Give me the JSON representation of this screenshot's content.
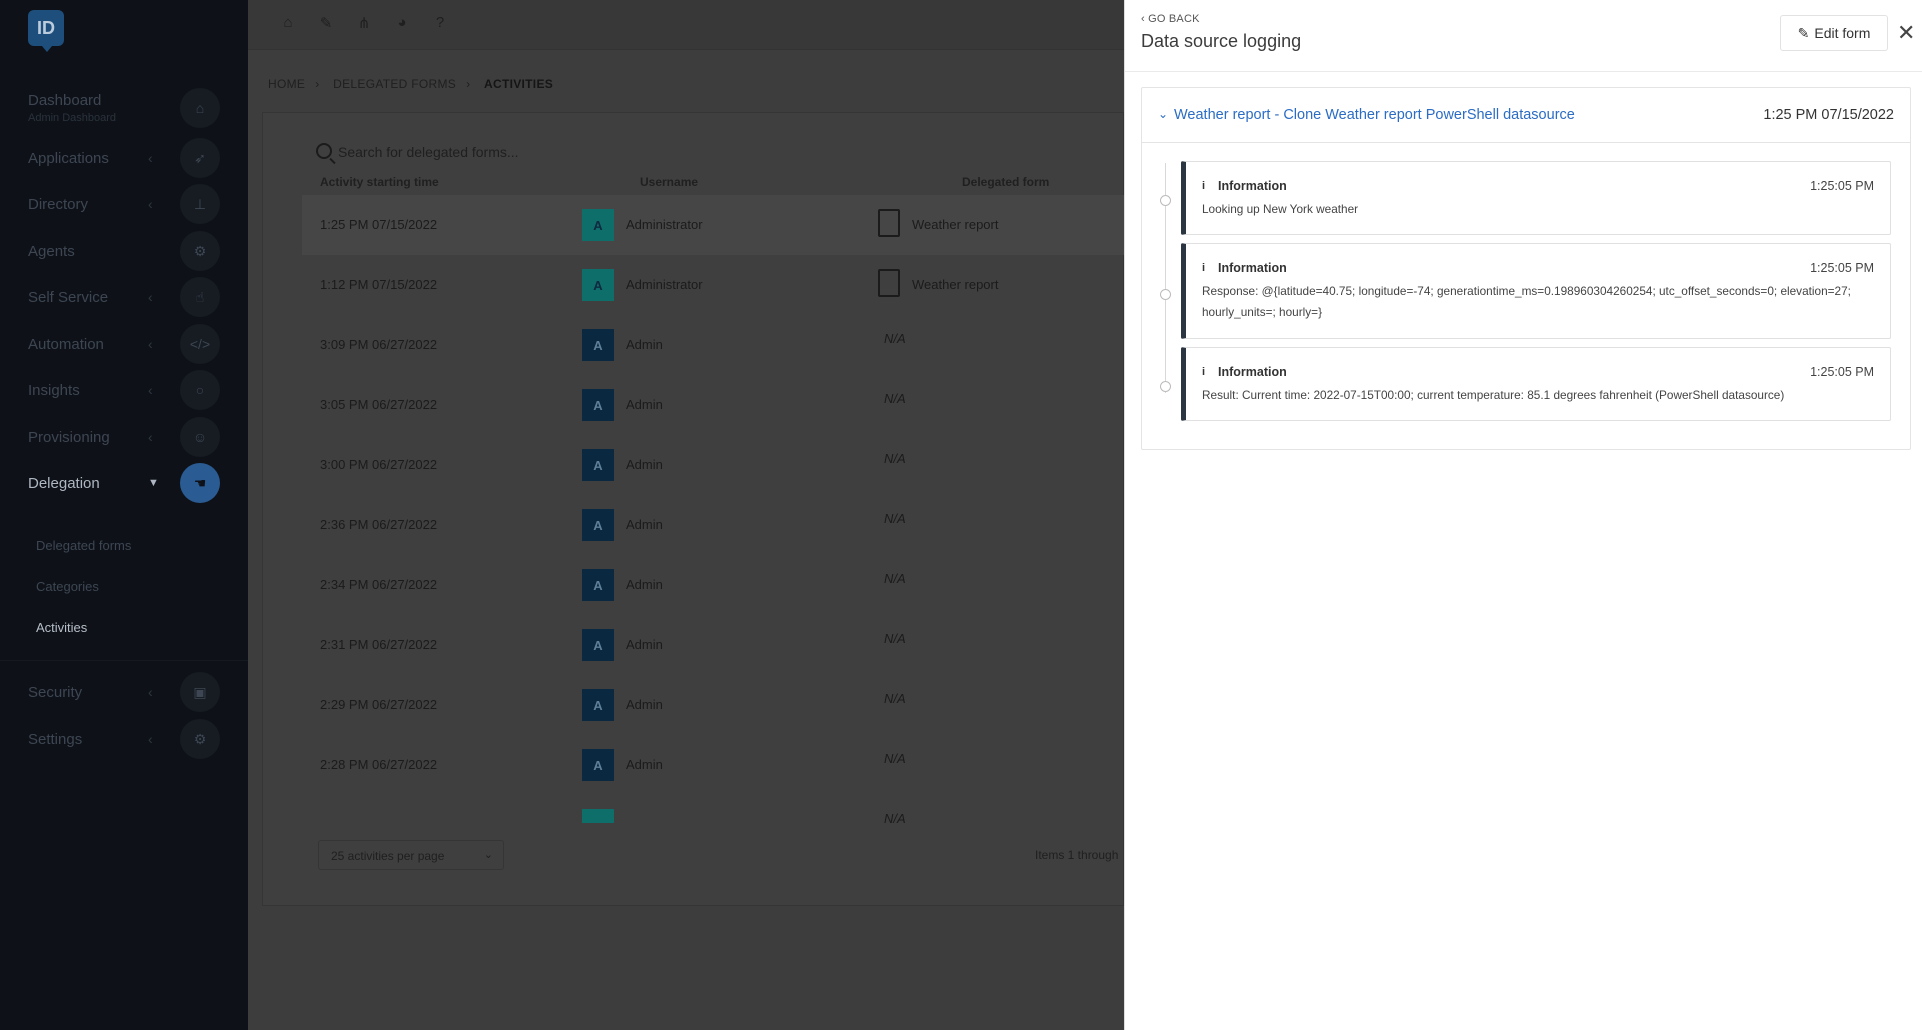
{
  "sidebar": {
    "logo": "ID",
    "items": [
      {
        "label": "Dashboard",
        "sub": "Admin Dashboard",
        "icon": "home-icon"
      },
      {
        "label": "Applications",
        "icon": "rocket-icon"
      },
      {
        "label": "Directory",
        "icon": "sitemap-icon"
      },
      {
        "label": "Agents",
        "icon": "cogs-icon"
      },
      {
        "label": "Self Service",
        "icon": "hand-pointer-icon"
      },
      {
        "label": "Automation",
        "icon": "code-icon"
      },
      {
        "label": "Insights",
        "icon": "lightbulb-icon"
      },
      {
        "label": "Provisioning",
        "icon": "users-icon"
      },
      {
        "label": "Delegation",
        "icon": "hand-icon"
      },
      {
        "label": "Security",
        "icon": "lock-icon"
      },
      {
        "label": "Settings",
        "icon": "gear-icon"
      }
    ],
    "subitems": [
      "Delegated forms",
      "Categories",
      "Activities"
    ]
  },
  "topbar": {
    "icons": [
      "home-icon",
      "wrench-icon",
      "share-icon",
      "pie-chart-icon",
      "help-icon"
    ]
  },
  "breadcrumb": [
    "HOME",
    "DELEGATED FORMS",
    "ACTIVITIES"
  ],
  "search": {
    "placeholder": "Search for delegated forms..."
  },
  "table": {
    "headers": [
      "Activity starting time",
      "Username",
      "Delegated form"
    ],
    "rows": [
      {
        "time": "1:25 PM 07/15/2022",
        "avatar": "A",
        "user": "Administrator",
        "form": "Weather report"
      },
      {
        "time": "1:12 PM 07/15/2022",
        "avatar": "A",
        "user": "Administrator",
        "form": "Weather report"
      },
      {
        "time": "3:09 PM 06/27/2022",
        "avatar": "A",
        "user": "Admin",
        "form": "N/A"
      },
      {
        "time": "3:05 PM 06/27/2022",
        "avatar": "A",
        "user": "Admin",
        "form": "N/A"
      },
      {
        "time": "3:00 PM 06/27/2022",
        "avatar": "A",
        "user": "Admin",
        "form": "N/A"
      },
      {
        "time": "2:36 PM 06/27/2022",
        "avatar": "A",
        "user": "Admin",
        "form": "N/A"
      },
      {
        "time": "2:34 PM 06/27/2022",
        "avatar": "A",
        "user": "Admin",
        "form": "N/A"
      },
      {
        "time": "2:31 PM 06/27/2022",
        "avatar": "A",
        "user": "Admin",
        "form": "N/A"
      },
      {
        "time": "2:29 PM 06/27/2022",
        "avatar": "A",
        "user": "Admin",
        "form": "N/A"
      },
      {
        "time": "2:28 PM 06/27/2022",
        "avatar": "A",
        "user": "Admin",
        "form": "N/A"
      }
    ],
    "partial_row_form": "N/A"
  },
  "pager": {
    "per_page": "25 activities per page",
    "items_text": "Items 1 through"
  },
  "panel": {
    "go_back": "GO BACK",
    "title": "Data source logging",
    "edit_label": "Edit form",
    "close": "✕",
    "card": {
      "title": "Weather report - Clone Weather report PowerShell datasource",
      "time": "1:25 PM 07/15/2022",
      "logs": [
        {
          "level": "Information",
          "time": "1:25:05 PM",
          "message": "Looking up New York weather"
        },
        {
          "level": "Information",
          "time": "1:25:05 PM",
          "message": "Response: @{latitude=40.75; longitude=-74; generationtime_ms=0.198960304260254; utc_offset_seconds=0; elevation=27; hourly_units=; hourly=}"
        },
        {
          "level": "Information",
          "time": "1:25:05 PM",
          "message": "Result: Current time: 2022-07-15T00:00; current temperature: 85.1 degrees fahrenheit (PowerShell datasource)"
        }
      ]
    }
  },
  "colors": {
    "accent": "#2b6cc4",
    "sidebar_bg": "#0e1218",
    "overlay": "#3d3d3d"
  }
}
